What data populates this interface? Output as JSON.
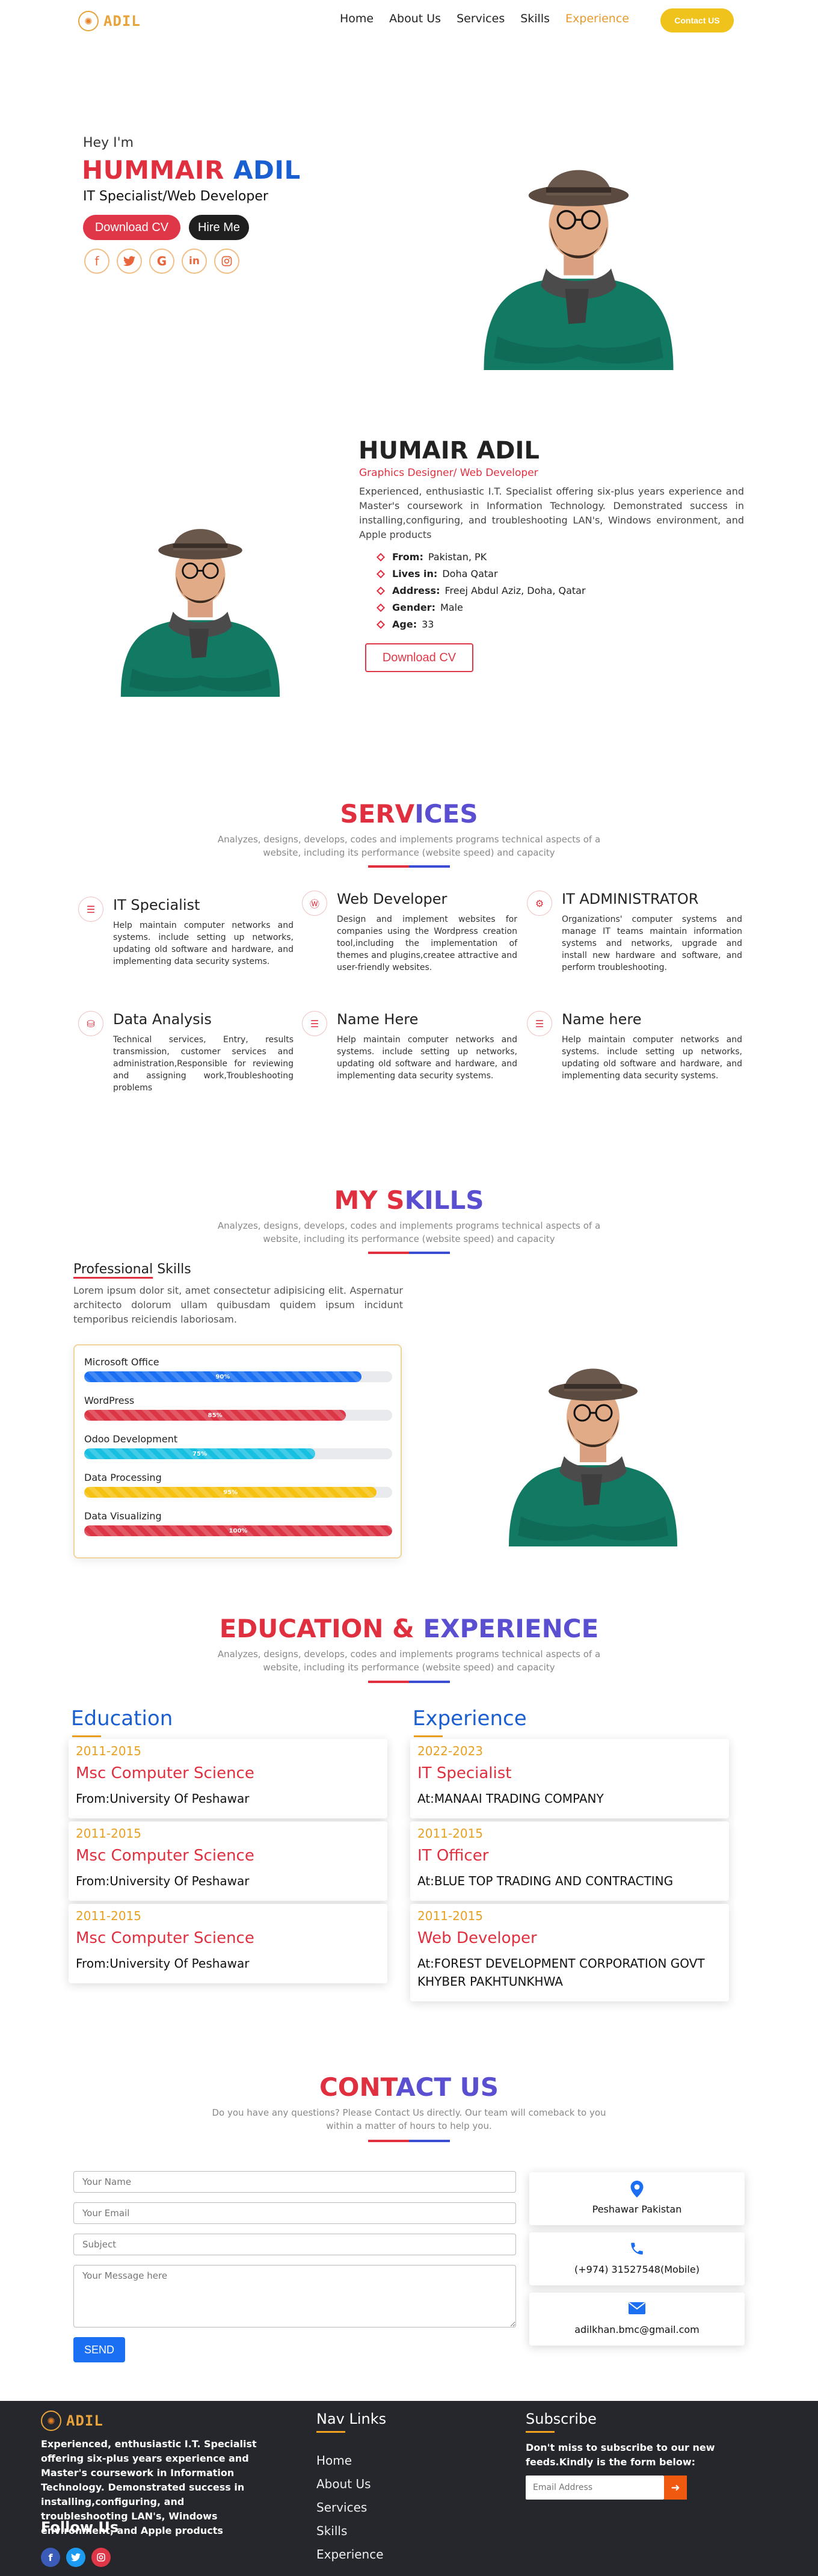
{
  "nav": {
    "logo_glyph": "✺",
    "logo_text": "ADIL",
    "links": [
      "Home",
      "About Us",
      "Services",
      "Skills",
      "Experience"
    ],
    "active_link": "Experience",
    "contact_label": "Contact US"
  },
  "hero": {
    "greeting": "Hey I'm",
    "name_first": "HUMMAIR",
    "name_last": "ADIL",
    "role": "IT Specialist/Web Developer",
    "download_label": "Download CV",
    "hire_label": "Hire Me",
    "socials": [
      "facebook-icon",
      "twitter-icon",
      "google-icon",
      "linkedin-icon",
      "instagram-icon"
    ]
  },
  "about": {
    "name": "HUMAIR ADIL",
    "role": "Graphics Designer/ Web Developer",
    "description": "Experienced, enthusiastic I.T. Specialist offering six-plus years experience and Master's coursework in Information Technology. Demonstrated success in installing,configuring, and troubleshooting LAN's, Windows environment, and Apple products",
    "details": [
      {
        "label": "From:",
        "value": "Pakistan, PK"
      },
      {
        "label": "Lives in:",
        "value": "Doha Qatar"
      },
      {
        "label": "Address:",
        "value": "Freej Abdul Aziz, Doha, Qatar"
      },
      {
        "label": "Gender:",
        "value": "Male"
      },
      {
        "label": "Age:",
        "value": "33"
      }
    ],
    "download_label": "Download CV"
  },
  "services": {
    "title_a": "SERV",
    "title_b": "ICES",
    "subtitle": "Analyzes, designs, develops, codes and implements programs technical aspects of a website, including its performance (website speed) and capacity",
    "items": [
      {
        "title": "IT Specialist",
        "desc": "Help maintain computer networks and systems. include setting up networks, updating old software and hardware, and implementing data security systems."
      },
      {
        "title": "Web Developer",
        "desc": "Design and implement websites for companies using the Wordpress creation tool,including the implementation of themes and plugins,createe attractive and user-friendly websites."
      },
      {
        "title": "IT ADMINISTRATOR",
        "desc": "Organizations' computer systems and manage IT teams maintain information systems and networks, upgrade and install new hardware and software, and perform troubleshooting."
      },
      {
        "title": "Data Analysis",
        "desc": "Technical services, Entry, results transmission, customer services and administration,Responsible for reviewing and assigning work,Troubleshooting problems"
      },
      {
        "title": "Name Here",
        "desc": "Help maintain computer networks and systems. include setting up networks, updating old software and hardware, and implementing data security systems."
      },
      {
        "title": "Name here",
        "desc": "Help maintain computer networks and systems. include setting up networks, updating old software and hardware, and implementing data security systems."
      }
    ]
  },
  "skills": {
    "title_a": "MY S",
    "title_b": "KILLS",
    "subtitle": "Analyzes, designs, develops, codes and implements programs technical aspects of a website, including its performance (website speed) and capacity",
    "prof_title_a": "Professional",
    "prof_title_b": " Skills",
    "prof_desc": "Lorem ipsum dolor sit, amet consectetur adipisicing elit. Aspernatur architecto dolorum ullam quibusdam quidem ipsum incidunt temporibus reiciendis laboriosam.",
    "items": [
      {
        "name": "Microsoft Office",
        "percent": "90%",
        "value": 0.9,
        "color": "#1a6ff2"
      },
      {
        "name": "WordPress",
        "percent": "85%",
        "value": 0.85,
        "color": "#dc3545"
      },
      {
        "name": "Odoo Development",
        "percent": "75%",
        "value": 0.75,
        "color": "#17c0e0"
      },
      {
        "name": "Data Processing",
        "percent": "95%",
        "value": 0.95,
        "color": "#f5c211"
      },
      {
        "name": "Data Visualizing",
        "percent": "100%",
        "value": 1.0,
        "color": "#dc3545"
      }
    ]
  },
  "resume": {
    "title_a": "EDUCATION",
    "title_mid": " & ",
    "title_b": "EXPERIENCE",
    "subtitle": "Analyzes, designs, develops, codes and implements programs technical aspects of a website, including its performance (website speed) and capacity",
    "education_head": "Education",
    "experience_head": "Experience",
    "education": [
      {
        "year": "2011-2015",
        "title": "Msc Computer Science",
        "sub": "From:University Of Peshawar"
      },
      {
        "year": "2011-2015",
        "title": "Msc Computer Science",
        "sub": "From:University Of Peshawar"
      },
      {
        "year": "2011-2015",
        "title": "Msc Computer Science",
        "sub": "From:University Of Peshawar"
      }
    ],
    "experience": [
      {
        "year": "2022-2023",
        "title": "IT Specialist",
        "sub": "At:MANAAI TRADING COMPANY"
      },
      {
        "year": "2011-2015",
        "title": "IT Officer",
        "sub": "At:BLUE TOP TRADING AND CONTRACTING"
      },
      {
        "year": "2011-2015",
        "title": "Web Developer",
        "sub": "At:FOREST DEVELOPMENT CORPORATION GOVT KHYBER PAKHTUNKHWA"
      }
    ]
  },
  "contact": {
    "title_a": "CONT",
    "title_b": "ACT US",
    "subtitle": "Do you have any questions? Please Contact Us directly. Our team will comeback to you within a matter of hours to help you.",
    "name_placeholder": "Your Name",
    "email_placeholder": "Your Email",
    "subject_placeholder": "Subject",
    "message_placeholder": "Your Message here",
    "send_label": "SEND",
    "info": [
      {
        "icon": "location-pin-icon",
        "text": "Peshawar Pakistan"
      },
      {
        "icon": "phone-icon",
        "text": "(+974) 31527548(Mobile)"
      },
      {
        "icon": "envelope-icon",
        "text": "adilkhan.bmc@gmail.com"
      }
    ]
  },
  "footer": {
    "logo_text": "ADIL",
    "description": "Experienced, enthusiastic I.T. Specialist offering six-plus years experience and Master's coursework in Information Technology. Demonstrated success in installing,configuring, and troubleshooting LAN's, Windows environment, and Apple products",
    "follow_label": "Follow Us",
    "nav_head": "Nav Links",
    "nav_links": [
      "Home",
      "About Us",
      "Services",
      "Skills",
      "Experience"
    ],
    "subscribe_head": "Subscribe",
    "subscribe_text": "Don't miss to subscribe to our new feeds.Kindly is the form below:",
    "email_placeholder": "Email Address",
    "submit_glyph": "➜"
  }
}
